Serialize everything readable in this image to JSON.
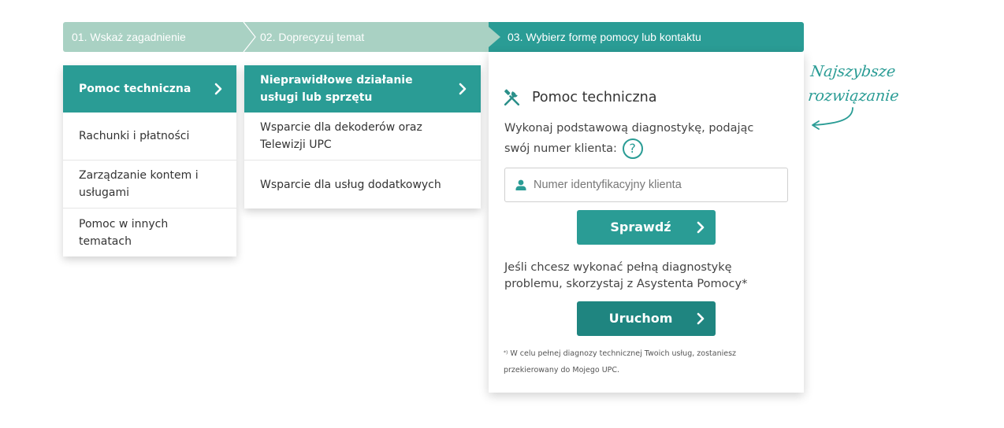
{
  "steps": [
    {
      "label": "01. Wskaż zagadnienie"
    },
    {
      "label": "02. Doprecyzuj temat"
    },
    {
      "label": "03. Wybierz formę pomocy lub kontaktu"
    }
  ],
  "menu_topics": {
    "items": [
      {
        "label": "Pomoc techniczna",
        "active": true
      },
      {
        "label": "Rachunki i płatności"
      },
      {
        "label": "Zarządzanie kontem i usługami"
      },
      {
        "label": "Pomoc w innych tematach"
      }
    ]
  },
  "menu_subtopics": {
    "items": [
      {
        "label": "Nieprawidłowe działanie usługi lub sprzętu",
        "active": true
      },
      {
        "label": "Wsparcie dla dekoderów oraz Telewizji UPC"
      },
      {
        "label": "Wsparcie dla usług dodatkowych"
      }
    ]
  },
  "panel": {
    "icon": "tools-icon",
    "title": "Pomoc techniczna",
    "description": "Wykonaj podstawową diagnostykę, podając swój numer klienta:",
    "help_icon": "?",
    "input_placeholder": "Numer identyfikacyjny klienta",
    "check_button": "Sprawdź",
    "description2": "Jeśli chcesz wykonać pełną diagnostykę problemu, skorzystaj z Asystenta Pomocy*",
    "run_button": "Uruchom",
    "footnote_mark": "*)",
    "footnote": "W celu pełnej diagnozy technicznej Twoich usług, zostaniesz przekierowany do Mojego UPC."
  },
  "note": {
    "line1": "Najszybsze",
    "line2": "rozwiązanie"
  },
  "colors": {
    "accent": "#2a9c95",
    "accent_dark": "#1f8580",
    "step_inactive": "#a9d1c3"
  }
}
